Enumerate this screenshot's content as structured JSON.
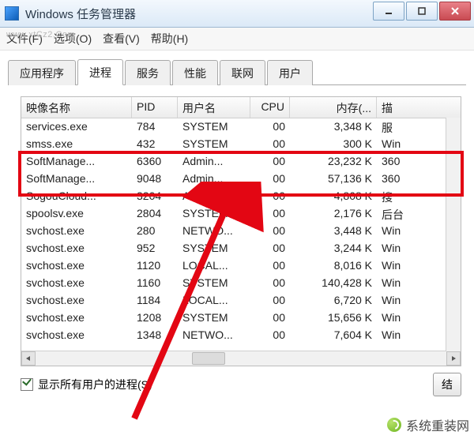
{
  "window": {
    "title": "Windows 任务管理器"
  },
  "watermark_url": "www.xtCz2.Com",
  "menubar": {
    "file": "文件(F)",
    "options": "选项(O)",
    "view": "查看(V)",
    "help": "帮助(H)"
  },
  "tabs": {
    "apps": "应用程序",
    "processes": "进程",
    "services": "服务",
    "performance": "性能",
    "network": "联网",
    "users": "用户"
  },
  "columns": {
    "name": "映像名称",
    "pid": "PID",
    "user": "用户名",
    "cpu": "CPU",
    "mem": "内存(...",
    "desc": "描"
  },
  "rows": [
    {
      "name": "services.exe",
      "pid": "784",
      "user": "SYSTEM",
      "cpu": "00",
      "mem": "3,348 K",
      "desc": "服"
    },
    {
      "name": "smss.exe",
      "pid": "432",
      "user": "SYSTEM",
      "cpu": "00",
      "mem": "300 K",
      "desc": "Win"
    },
    {
      "name": "SoftManage...",
      "pid": "6360",
      "user": "Admin...",
      "cpu": "00",
      "mem": "23,232 K",
      "desc": "360"
    },
    {
      "name": "SoftManage...",
      "pid": "9048",
      "user": "Admin...",
      "cpu": "00",
      "mem": "57,136 K",
      "desc": "360"
    },
    {
      "name": "SogouCloud...",
      "pid": "3204",
      "user": "Admin...",
      "cpu": "00",
      "mem": "4,808 K",
      "desc": "搜"
    },
    {
      "name": "spoolsv.exe",
      "pid": "2804",
      "user": "SYSTEM",
      "cpu": "00",
      "mem": "2,176 K",
      "desc": "后台"
    },
    {
      "name": "svchost.exe",
      "pid": "280",
      "user": "NETWO...",
      "cpu": "00",
      "mem": "3,448 K",
      "desc": "Win"
    },
    {
      "name": "svchost.exe",
      "pid": "952",
      "user": "SYSTEM",
      "cpu": "00",
      "mem": "3,244 K",
      "desc": "Win"
    },
    {
      "name": "svchost.exe",
      "pid": "1120",
      "user": "LOCAL...",
      "cpu": "00",
      "mem": "8,016 K",
      "desc": "Win"
    },
    {
      "name": "svchost.exe",
      "pid": "1160",
      "user": "SYSTEM",
      "cpu": "00",
      "mem": "140,428 K",
      "desc": "Win"
    },
    {
      "name": "svchost.exe",
      "pid": "1184",
      "user": "LOCAL...",
      "cpu": "00",
      "mem": "6,720 K",
      "desc": "Win"
    },
    {
      "name": "svchost.exe",
      "pid": "1208",
      "user": "SYSTEM",
      "cpu": "00",
      "mem": "15,656 K",
      "desc": "Win"
    },
    {
      "name": "svchost.exe",
      "pid": "1348",
      "user": "NETWO...",
      "cpu": "00",
      "mem": "7,604 K",
      "desc": "Win"
    }
  ],
  "showall": "显示所有用户的进程(S)",
  "endbtn": "结",
  "brand": "系统重装网"
}
